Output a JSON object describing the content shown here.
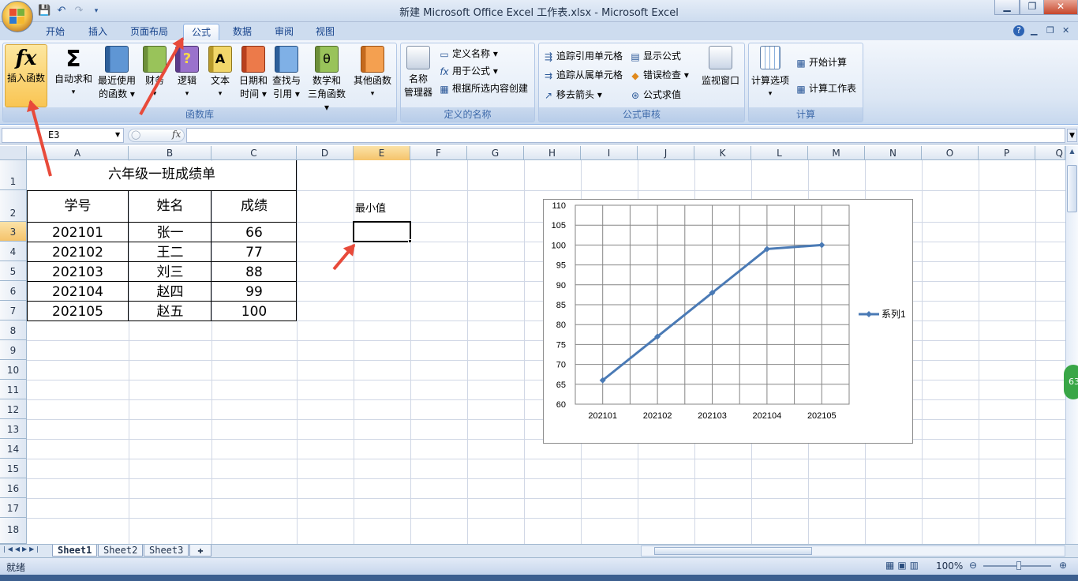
{
  "window": {
    "title": "新建 Microsoft Office Excel 工作表.xlsx - Microsoft Excel",
    "minimize": "▁",
    "restore": "❐",
    "close": "✕"
  },
  "ribbon_tabs": [
    "开始",
    "插入",
    "页面布局",
    "公式",
    "数据",
    "审阅",
    "视图"
  ],
  "active_tab": "公式",
  "groups": {
    "function_library": {
      "label": "函数库",
      "insert_function": {
        "icon": "fx",
        "label": "插入函数"
      },
      "autosum": {
        "icon": "Σ",
        "label1": "自动求和",
        "label2": "▾"
      },
      "recent": {
        "label1": "最近使用",
        "label2": "的函数 ▾"
      },
      "financial": {
        "label1": "财务",
        "label2": "▾"
      },
      "logical": {
        "label1": "逻辑",
        "label2": "▾"
      },
      "text": {
        "label1": "文本",
        "label2": "▾"
      },
      "datetime": {
        "label1": "日期和",
        "label2": "时间 ▾"
      },
      "lookup": {
        "label1": "查找与",
        "label2": "引用 ▾"
      },
      "math": {
        "label1": "数学和",
        "label2": "三角函数 ▾"
      },
      "other": {
        "label1": "其他函数",
        "label2": "▾"
      }
    },
    "defined_names": {
      "label": "定义的名称",
      "name_manager": {
        "label1": "名称",
        "label2": "管理器"
      },
      "define_name": "定义名称 ▾",
      "use_in_formula": "用于公式 ▾",
      "create_from_selection": "根据所选内容创建"
    },
    "formula_auditing": {
      "label": "公式审核",
      "trace_precedents": "追踪引用单元格",
      "trace_dependents": "追踪从属单元格",
      "remove_arrows": "移去箭头 ▾",
      "show_formulas": "显示公式",
      "error_checking": "错误检查 ▾",
      "evaluate_formula": "公式求值",
      "watch_window": "监视窗口"
    },
    "calculation": {
      "label": "计算",
      "calc_options": {
        "label1": "计算选项",
        "label2": "▾"
      },
      "calc_now": "开始计算",
      "calc_sheet": "计算工作表"
    }
  },
  "formula_bar": {
    "name_box": "E3",
    "fx": "fx",
    "value": ""
  },
  "columns": [
    "A",
    "B",
    "C",
    "D",
    "E",
    "F",
    "G",
    "H",
    "I",
    "J",
    "K",
    "L",
    "M",
    "N",
    "O",
    "P",
    "Q"
  ],
  "selected_column": "E",
  "rows": [
    "1",
    "2",
    "3",
    "4",
    "5",
    "6",
    "7",
    "8",
    "9",
    "10",
    "11",
    "12",
    "13",
    "14",
    "15",
    "16",
    "17",
    "18"
  ],
  "selected_row": "3",
  "table": {
    "title": "六年级一班成绩单",
    "headers": [
      "学号",
      "姓名",
      "成绩"
    ],
    "records": [
      [
        "202101",
        "张一",
        "66"
      ],
      [
        "202102",
        "王二",
        "77"
      ],
      [
        "202103",
        "刘三",
        "88"
      ],
      [
        "202104",
        "赵四",
        "99"
      ],
      [
        "202105",
        "赵五",
        "100"
      ]
    ]
  },
  "label_min": "最小值",
  "chart_data": {
    "type": "line",
    "categories": [
      "202101",
      "202102",
      "202103",
      "202104",
      "202105"
    ],
    "series": [
      {
        "name": "系列1",
        "values": [
          66,
          77,
          88,
          99,
          100
        ]
      }
    ],
    "ylim": [
      60,
      110
    ],
    "ytick_step": 5,
    "yticks": [
      "60",
      "65",
      "70",
      "75",
      "80",
      "85",
      "90",
      "95",
      "100",
      "105",
      "110"
    ],
    "grid": true,
    "legend": "right",
    "color": "#4a7ab5"
  },
  "sheets": [
    "Sheet1",
    "Sheet2",
    "Sheet3"
  ],
  "active_sheet": "Sheet1",
  "status": {
    "ready": "就绪",
    "zoom": "100%"
  },
  "colors": {
    "accent": "#15428b",
    "annotation_arrow": "#e84a3a"
  }
}
